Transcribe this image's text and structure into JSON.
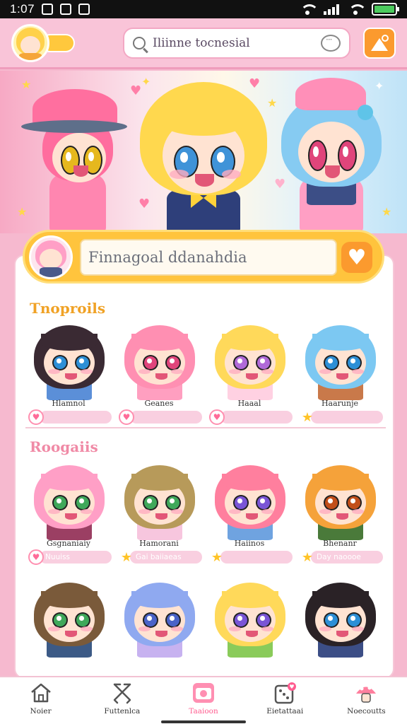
{
  "status_bar": {
    "time": "1:07"
  },
  "header": {
    "search_text": "Iliinne tocnesial"
  },
  "featured": {
    "input_text": "Finnagoal ddanahdia"
  },
  "sections": [
    {
      "title": "Tnoproils",
      "title_color": "#f0a226",
      "cards": [
        {
          "name": "Hlamnol",
          "tag": "",
          "tag_icon": "heart",
          "hair": "#3a2a33",
          "eyes": "#2d8fd6",
          "outfit": "#5b8fd8"
        },
        {
          "name": "Geanes",
          "tag": "",
          "tag_icon": "heart",
          "hair": "#ff8fb2",
          "eyes": "#e0457b",
          "outfit": "#ff9fc0"
        },
        {
          "name": "Haaal",
          "tag": "",
          "tag_icon": "heart",
          "hair": "#ffd95a",
          "eyes": "#b06ad8",
          "outfit": "#ffd1e2"
        },
        {
          "name": "Haarunje",
          "tag": "",
          "tag_icon": "star",
          "hair": "#7cc8f2",
          "eyes": "#2d8fd6",
          "outfit": "#c9794a"
        }
      ]
    },
    {
      "title": "Roogaiis",
      "title_color": "#f08aa6",
      "cards": [
        {
          "name": "Gsgnaniaiy",
          "tag": "Nuuiss",
          "tag_icon": "heart",
          "hair": "#ff9fc6",
          "eyes": "#3fa85a",
          "outfit": "#9b3f63"
        },
        {
          "name": "Hamorani",
          "tag": "Gai baiiaeas",
          "tag_icon": "star",
          "hair": "#b79a5a",
          "eyes": "#3fa85a",
          "outfit": "#f7c6de"
        },
        {
          "name": "Haiinos",
          "tag": "",
          "tag_icon": "star",
          "hair": "#ff7f9e",
          "eyes": "#7a55d6",
          "outfit": "#6fa3e0"
        },
        {
          "name": "Bhenanr",
          "tag": "Day naoooe",
          "tag_icon": "star",
          "hair": "#f5a23a",
          "eyes": "#c24f1a",
          "outfit": "#4a7a3a"
        }
      ]
    },
    {
      "title": "",
      "title_color": "",
      "cards": [
        {
          "name": "",
          "tag": "",
          "tag_icon": "",
          "hair": "#7a5a3a",
          "eyes": "#3fa85a",
          "outfit": "#3c5a86"
        },
        {
          "name": "",
          "tag": "",
          "tag_icon": "",
          "hair": "#8fa9f0",
          "eyes": "#4a63c8",
          "outfit": "#c7b2f0"
        },
        {
          "name": "",
          "tag": "",
          "tag_icon": "",
          "hair": "#ffd95a",
          "eyes": "#7a55d6",
          "outfit": "#8acb5a"
        },
        {
          "name": "",
          "tag": "",
          "tag_icon": "",
          "hair": "#2a2226",
          "eyes": "#2d8fd6",
          "outfit": "#3c4e86"
        }
      ]
    }
  ],
  "bottom_nav": [
    {
      "label": "Noier",
      "icon": "home-icon",
      "active": false
    },
    {
      "label": "Futtenlca",
      "icon": "ribbon-icon",
      "active": false
    },
    {
      "label": "Taaioon",
      "icon": "camera-icon",
      "active": true
    },
    {
      "label": "Eietattaai",
      "icon": "dice-icon",
      "active": false
    },
    {
      "label": "Noecoutts",
      "icon": "mushroom-icon",
      "active": false
    }
  ],
  "colors": {
    "accent_pink": "#ff5c8f",
    "accent_orange": "#fb9a2e",
    "accent_yellow": "#ffc43d"
  }
}
